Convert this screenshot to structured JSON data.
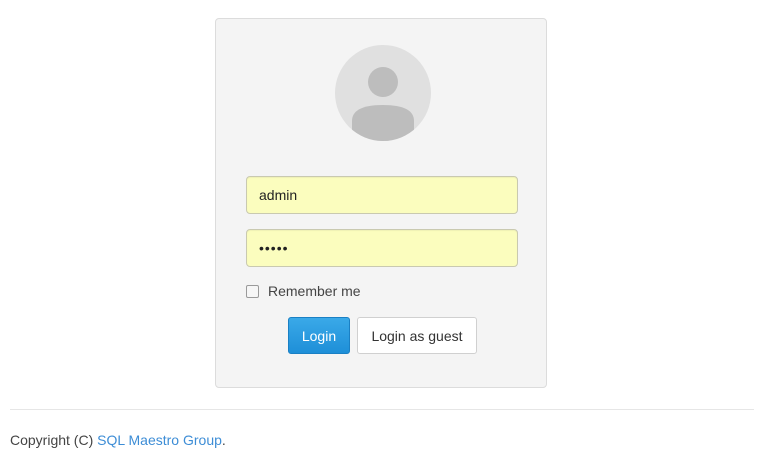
{
  "login": {
    "avatar_icon": "user-avatar-icon",
    "username_value": "admin",
    "password_value": "•••••",
    "remember_label": "Remember me",
    "remember_checked": false,
    "login_button": "Login",
    "guest_button": "Login as guest"
  },
  "footer": {
    "prefix": "Copyright (C) ",
    "link_text": "SQL Maestro Group",
    "suffix": "."
  },
  "colors": {
    "input_background": "#fbfdbe",
    "primary_button": "#2a9be0",
    "link": "#3d8dd6",
    "panel_background": "#f4f4f4"
  }
}
